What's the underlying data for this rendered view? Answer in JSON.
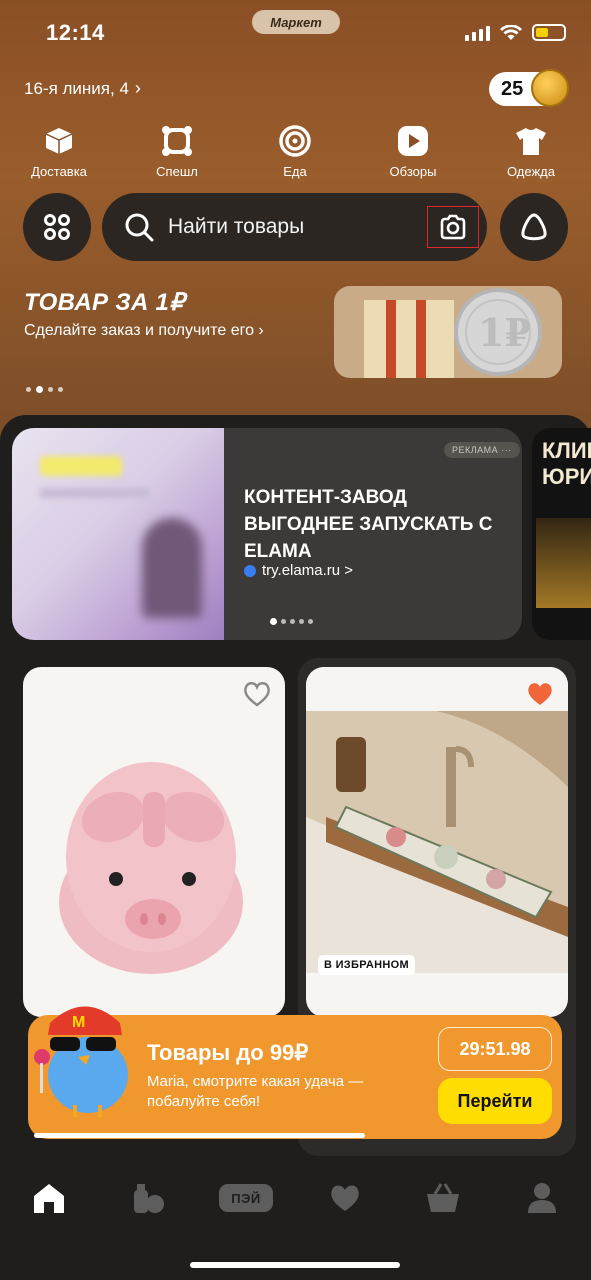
{
  "status_bar": {
    "time": "12:14",
    "app_pill": "Маркет"
  },
  "header": {
    "address": "16-я линия, 4",
    "coins": "25"
  },
  "categories": [
    {
      "label": "Доставка",
      "icon": "box-icon"
    },
    {
      "label": "Спешл",
      "icon": "special-icon"
    },
    {
      "label": "Еда",
      "icon": "food-icon"
    },
    {
      "label": "Обзоры",
      "icon": "play-icon"
    },
    {
      "label": "Одежда",
      "icon": "tshirt-icon"
    }
  ],
  "search": {
    "placeholder": "Найти товары"
  },
  "promo": {
    "title": "ТОВАР ЗА 1₽",
    "subtitle": "Сделайте заказ и получите его ›"
  },
  "ad": {
    "badge": "РЕКЛАМА ···",
    "title": "КОНТЕНТ-ЗАВОД ВЫГОДНЕЕ ЗАПУСКАТЬ С ELAMA",
    "link": "try.elama.ru >",
    "next_title": "КЛИЕ ЮРИС"
  },
  "products": [
    {
      "name": "pig-mouse",
      "favorite": false
    },
    {
      "name": "sink-mat",
      "favorite": true,
      "tag": "В ИЗБРАННОМ"
    }
  ],
  "banner": {
    "title": "Товары до 99₽",
    "subtitle": "Maria, смотрите какая удача — побалуйте себя!",
    "timer": "29:51.98",
    "button": "Перейти",
    "progress": 0.62
  },
  "tabbar": {
    "pay_label": "ПЭЙ"
  },
  "colors": {
    "accent_yellow": "#ffdd00",
    "banner_orange": "#f0982e",
    "heart_orange": "#f0663a",
    "hero_brown": "#8a4f26"
  }
}
